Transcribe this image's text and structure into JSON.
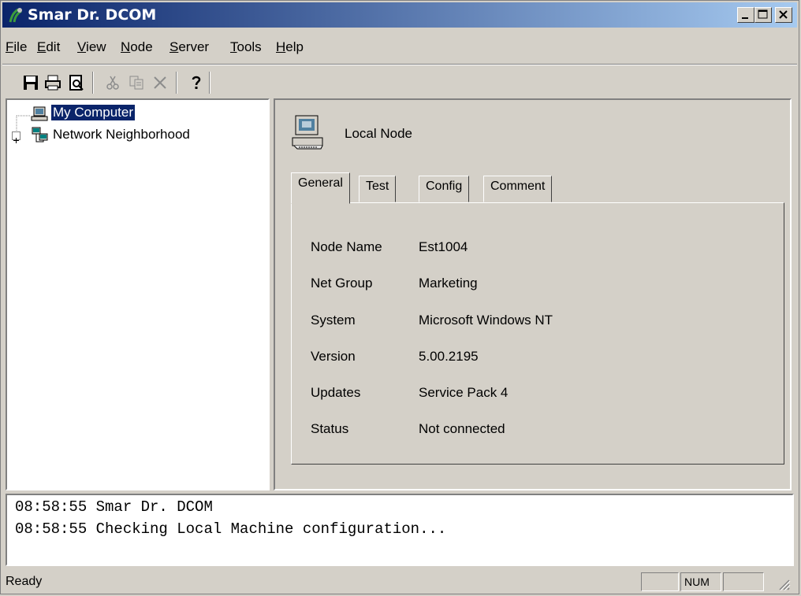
{
  "window": {
    "title": "Smar Dr. DCOM"
  },
  "menubar": [
    {
      "pre": "",
      "u": "F",
      "post": "ile"
    },
    {
      "pre": "",
      "u": "E",
      "post": "dit"
    },
    {
      "pre": "",
      "u": "V",
      "post": "iew"
    },
    {
      "pre": "",
      "u": "N",
      "post": "ode"
    },
    {
      "pre": "",
      "u": "S",
      "post": "erver"
    },
    {
      "pre": "",
      "u": "T",
      "post": "ools"
    },
    {
      "pre": "",
      "u": "H",
      "post": "elp"
    }
  ],
  "toolbar": {
    "icons": [
      "save-icon",
      "print-icon",
      "print-preview-icon",
      "cut-icon",
      "copy-icon",
      "delete-icon",
      "help-icon"
    ]
  },
  "tree": {
    "items": [
      {
        "label": "My Computer",
        "selected": true
      },
      {
        "label": "Network Neighborhood",
        "selected": false
      }
    ]
  },
  "node": {
    "title": "Local Node"
  },
  "tabs": [
    "General",
    "Test",
    "Config",
    "Comment"
  ],
  "active_tab": "General",
  "properties": [
    {
      "label": "Node Name",
      "value": "Est1004"
    },
    {
      "label": "Net Group",
      "value": "Marketing"
    },
    {
      "label": "System",
      "value": "Microsoft Windows NT"
    },
    {
      "label": "Version",
      "value": "5.00.2195"
    },
    {
      "label": "Updates",
      "value": "Service Pack 4"
    },
    {
      "label": "Status",
      "value": "Not connected"
    }
  ],
  "log": [
    "08:58:55 Smar Dr. DCOM",
    "08:58:55 Checking Local Machine configuration..."
  ],
  "statusbar": {
    "text": "Ready",
    "num": "NUM"
  },
  "colors": {
    "titlebar_start": "#0a246a",
    "titlebar_end": "#a6caf0",
    "face": "#d4d0c8",
    "selection": "#0a246a"
  }
}
